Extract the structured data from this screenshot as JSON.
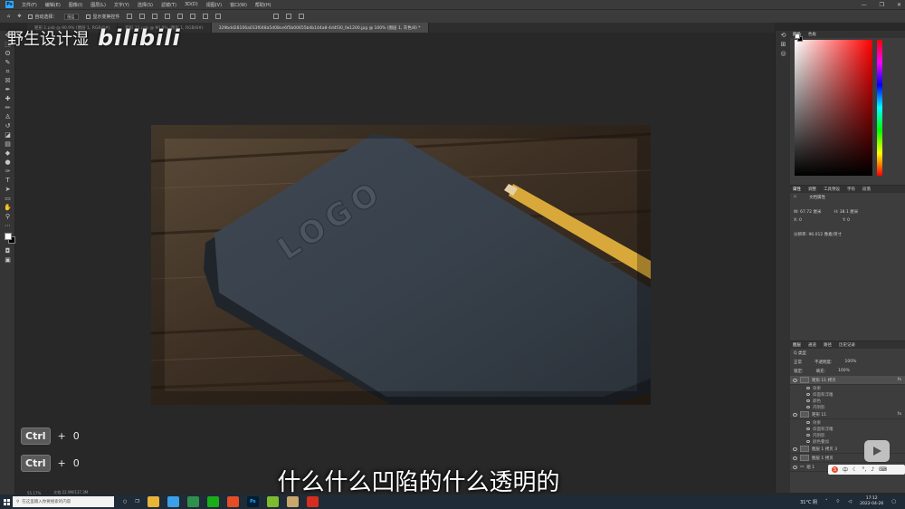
{
  "menubar": {
    "items": [
      "文件(F)",
      "编辑(E)",
      "图像(I)",
      "图层(L)",
      "文字(Y)",
      "选择(S)",
      "滤镜(T)",
      "3D(D)",
      "视图(V)",
      "窗口(W)",
      "帮助(H)"
    ],
    "window_controls": [
      "—",
      "❐",
      "✕"
    ]
  },
  "options": {
    "auto_select_label": "自动选择：",
    "auto_select_value": "图层",
    "show_transform_label": "显示变换控件"
  },
  "tabs": [
    {
      "label": "矩形 1.psb @ 90.9% (图层 1, RGB/8#)",
      "active": false
    },
    {
      "label": "矩形 12.psb @ 90.9% (图层 1, RGB/8#)",
      "active": false
    },
    {
      "label": "329bdd28106a033f048a5d08ce6f5b00655b4b144a8-4d4f30_fw1200.jpg @ 100% (图层 1, 灰色/8) *",
      "active": true
    }
  ],
  "photo": {
    "emboss_text": "LOGO"
  },
  "status": {
    "zoom": "55.17%",
    "doc": "文档:22.9M/137.3M"
  },
  "panels": {
    "color_tabs": [
      "颜色",
      "色板"
    ],
    "props_tabs": [
      "属性",
      "调整",
      "工具预设",
      "字符",
      "段落"
    ],
    "props_title": "文档属性",
    "w_label": "W: 67.72 厘米",
    "h_label": "H: 38.1 厘米",
    "x_label": "X: 0",
    "y_label": "Y: 0",
    "resolution": "分辨率: 96.012 像素/英寸",
    "layers_tabs": [
      "图层",
      "通道",
      "路径",
      "历史记录"
    ],
    "kind_label": "Q 类型",
    "mode_label": "正常",
    "opacity_label": "不透明度:",
    "opacity_value": "100%",
    "lock_label": "锁定:",
    "fill_label": "填充:",
    "fill_value": "100%",
    "layers": [
      {
        "name": "矩形 11 拷贝",
        "fx": "fx",
        "effects": [
          "效果",
          "斜面和浮雕",
          "颜色",
          "内阴影"
        ]
      },
      {
        "name": "矩形 11",
        "fx": "fx",
        "effects": [
          "效果",
          "斜面和浮雕",
          "内阴影",
          "颜色叠加"
        ]
      },
      {
        "name": "图层 1 拷贝 3",
        "fx": "",
        "effects": []
      },
      {
        "name": "图层 1 拷贝",
        "fx": "",
        "effects": []
      },
      {
        "name": "组 1",
        "fx": "",
        "effects": []
      }
    ]
  },
  "overlay": {
    "watermark_text": "野生设计湿",
    "watermark_logo": "bilibili",
    "shortcuts": [
      {
        "key": "Ctrl",
        "plus": "+",
        "value": "0"
      },
      {
        "key": "Ctrl",
        "plus": "+",
        "value": "0"
      }
    ],
    "subtitle": "什么什么凹陷的什么透明的",
    "ime_label": "中"
  },
  "taskbar": {
    "search_placeholder": "在这里输入你要搜索的内容",
    "weather": "31°C 阴",
    "time": "17:12",
    "date": "2022-04-26",
    "apps": [
      {
        "label": "",
        "color": "#e9b43a"
      },
      {
        "label": "",
        "color": "#3aa0e9"
      },
      {
        "label": "",
        "color": "#2f8f4e"
      },
      {
        "label": "",
        "color": "#1aad19"
      },
      {
        "label": "",
        "color": "#e44d26"
      },
      {
        "label": "Ps",
        "color": "#001e36"
      },
      {
        "label": "",
        "color": "#7dbb2f"
      },
      {
        "label": "",
        "color": "#c9a66b"
      },
      {
        "label": "",
        "color": "#d62d20"
      }
    ]
  }
}
